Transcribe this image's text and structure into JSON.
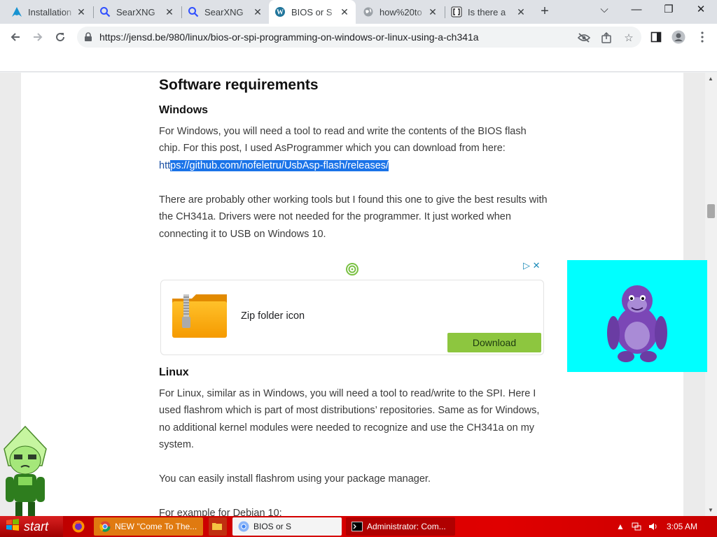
{
  "tabs": [
    {
      "label": "Installation",
      "icon": "arch-icon"
    },
    {
      "label": "SearXNG",
      "icon": "search-icon"
    },
    {
      "label": "SearXNG",
      "icon": "search-icon"
    },
    {
      "label": "BIOS or S",
      "icon": "wordpress-icon"
    },
    {
      "label": "how%20to",
      "icon": "globe-icon"
    },
    {
      "label": "Is there a",
      "icon": "bracket-icon"
    }
  ],
  "address_bar": {
    "url": "https://jensd.be/980/linux/bios-or-spi-programming-on-windows-or-linux-using-a-ch341a"
  },
  "article": {
    "heading": "Software requirements",
    "windows_heading": "Windows",
    "windows_para1": "For Windows, you will need a tool to read and write the contents of the BIOS flash chip. For this post, I used AsProgrammer which you can download from here:",
    "link_prefix": "htt",
    "link_selected": "ps://github.com/nofeletru/UsbAsp-flash/releases/",
    "windows_para2": "There are probably other working tools but I found this one to give the best results with the CH341a. Drivers were not needed for the programmer. It just worked when connecting it to USB on Windows 10.",
    "linux_heading": "Linux",
    "linux_para1": "For Linux, similar as in Windows, you will need a tool to read/write to the SPI. Here I used flashrom which is part of most distributions’ repositories. Same as for Windows, no additional kernel modules were needed to recognize and use the CH341a on my system.",
    "linux_para2": "You can easily install flashrom using your package manager.",
    "linux_para3": "For example for Debian 10:"
  },
  "ad": {
    "title": "Zip folder icon",
    "button": "Download",
    "adchoices": "▷ ✕"
  },
  "taskbar": {
    "start": "start",
    "buttons": [
      {
        "label": "NEW \"Come To The...",
        "icon": "chrome-icon"
      },
      {
        "label": "BIOS or S",
        "icon": "chrome-icon"
      },
      {
        "label": "Administrator: Com...",
        "icon": "cmd-icon"
      }
    ],
    "clock": "3:05 AM"
  },
  "colors": {
    "selection": "#1a73e8",
    "ad_button": "#8dc63f",
    "taskbar": "#d40000",
    "cyan_box": "#00ffff"
  }
}
